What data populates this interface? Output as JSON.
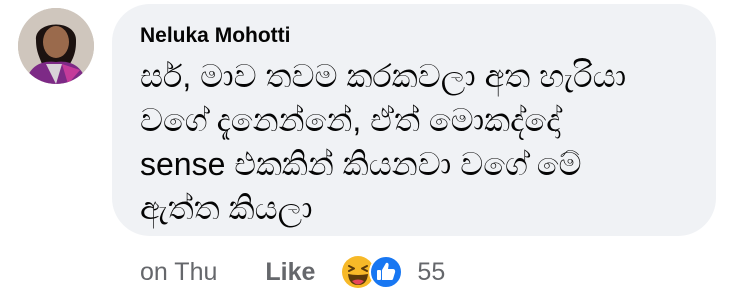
{
  "comment": {
    "author": "Neluka Mohotti",
    "lines": [
      "සර්, මාව තවම කරකවලා අත හැරියා",
      "වගේ දැනෙන්නේ, ඒත් මොකද්දෝ",
      "sense එකකින් කියනවා වගේ මේ",
      "ඇත්ත කියලා"
    ],
    "time": "on Thu",
    "like_label": "Like",
    "reactions": {
      "icons": [
        "laughing-emoji-icon",
        "thumbs-up-icon"
      ],
      "count": "55"
    }
  },
  "colors": {
    "bubble_bg": "#f0f2f5",
    "text": "#050505",
    "secondary_text": "#65676b",
    "like_blue": "#1877f2",
    "haha_yellow": "#f7b928"
  }
}
